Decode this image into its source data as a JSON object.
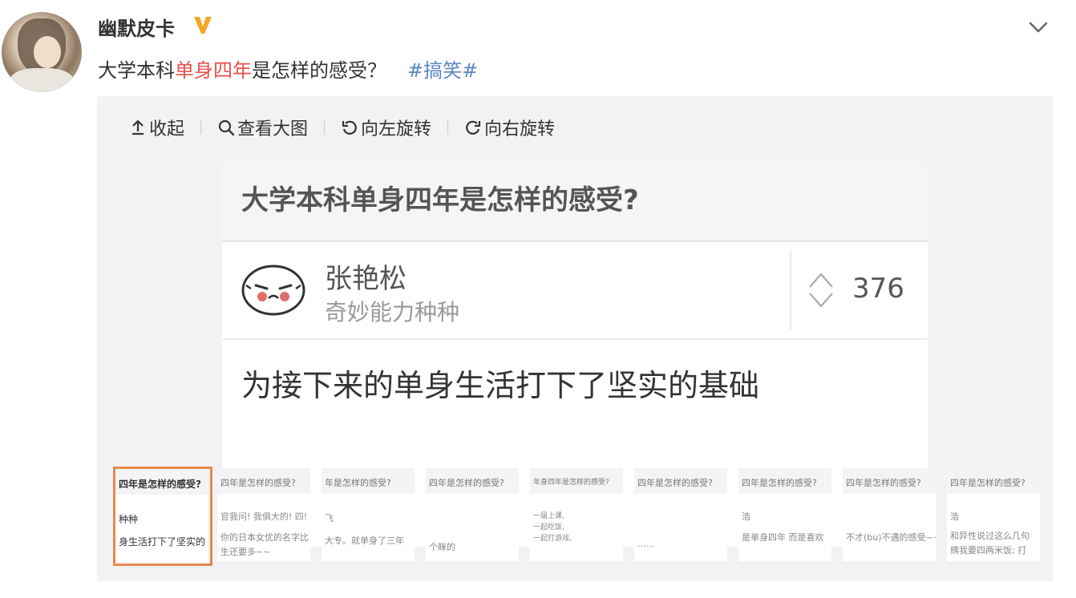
{
  "post": {
    "username": "幽默皮卡",
    "text_before": "大学本科",
    "text_highlight": "单身四年",
    "text_after": "是怎样的感受？",
    "hashtag": "#搞笑#"
  },
  "toolbar": {
    "collapse_label": "收起",
    "view_large_label": "查看大图",
    "rotate_left_label": "向左旋转",
    "rotate_right_label": "向右旋转"
  },
  "image": {
    "question_title": "大学本科单身四年是怎样的感受?",
    "answer_author": "张艳松",
    "answer_author_bio": "奇妙能力种种",
    "vote_count": "376",
    "answer_text": "为接下来的单身生活打下了坚实的基础"
  },
  "thumbnails": [
    {
      "title": "四年是怎样的感受?",
      "line1": "种种",
      "line2": "身生活打下了坚实的"
    },
    {
      "title": "四年是怎样的感受?",
      "line1": "官我问! 我俱大的! 四!",
      "line2": "你的日本女优的名字比",
      "line3": "生还要多~~"
    },
    {
      "title": "年是怎样的感受?",
      "line1": "飞",
      "line2": "大专。就单身了三年"
    },
    {
      "title": "四年是怎样的感受?",
      "line1": "",
      "line2": "个眯的"
    },
    {
      "title": "年身四年是怎样的感受?",
      "line1": "一届上课,",
      "line2": "一起吃饭,",
      "line3": "一起打游戏,"
    },
    {
      "title": "四年是怎样的感受?",
      "line1": "",
      "line2": "......"
    },
    {
      "title": "四年是怎样的感受?",
      "line1": "浩",
      "line2": "是单身四年 而是喜欢"
    },
    {
      "title": "四年是怎样的感受?",
      "line1": "",
      "line2": "不才(bu)不遇的感受~~"
    },
    {
      "title": "四年是怎样的感受?",
      "line1": "浩",
      "line2": "和异性说过这么几句",
      "line3": "姨我要四两米饭; 打"
    }
  ],
  "colors": {
    "highlight": "#e8504c",
    "hashtag": "#5b86c5",
    "active_thumb_border": "#e8894c",
    "verified_badge": "#f5a623"
  }
}
